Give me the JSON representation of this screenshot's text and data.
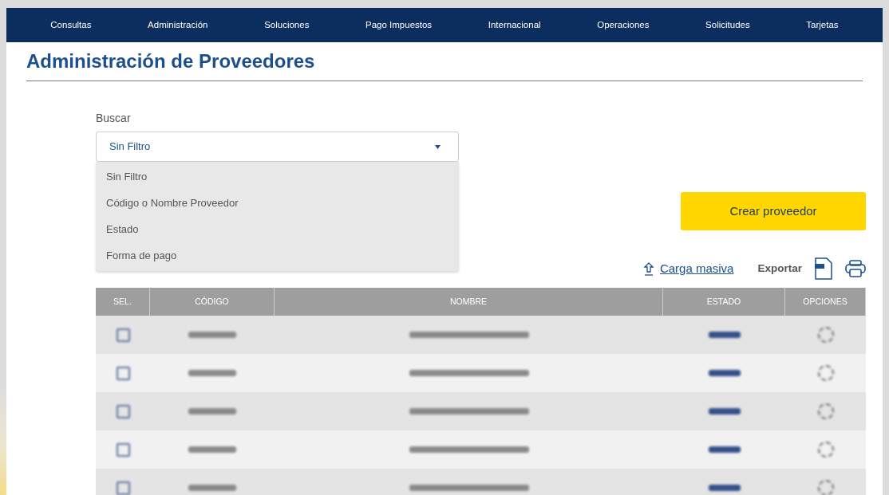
{
  "nav": {
    "items": [
      "Consultas",
      "Administración",
      "Soluciones",
      "Pago Impuestos",
      "Internacional",
      "Operaciones",
      "Solicitudes",
      "Tarjetas"
    ]
  },
  "page_title": "Administración de Proveedores",
  "search": {
    "label": "Buscar",
    "value": "Sin Filtro",
    "expanded": true,
    "options": [
      {
        "label": "Sin Filtro"
      },
      {
        "label": "Código o Nombre Proveedor"
      },
      {
        "label": "Estado"
      },
      {
        "label": "Forma de pago"
      }
    ]
  },
  "create_button": "Crear proveedor",
  "actions": {
    "upload_link": "Carga masiva",
    "export_label": "Exportar"
  },
  "table": {
    "columns": [
      "SEL.",
      "CÓDIGO",
      "NOMBRE",
      "ESTADO",
      "OPCIONES"
    ],
    "rows": [
      {
        "blurred": true
      },
      {
        "blurred": true
      },
      {
        "blurred": true
      },
      {
        "blurred": true
      },
      {
        "blurred": true
      }
    ]
  }
}
